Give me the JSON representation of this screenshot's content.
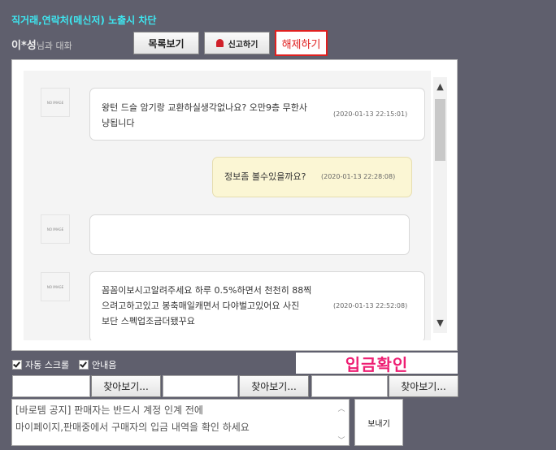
{
  "header": {
    "warning": "직거래,연락처(메신저) 노출시 차단",
    "user_name": "이*성",
    "user_suffix": "님과 대화",
    "list_button": "목록보기",
    "report_button": "신고하기",
    "release_button": "해제하기"
  },
  "chat": {
    "avatar_text": "NO IMAGE",
    "messages": [
      {
        "side": "them",
        "lines": [
          "왕턴 드슬 암기랑 교환하실생각없나요? 오만9층 무한사",
          "냥됩니다"
        ],
        "time": "(2020-01-13 22:15:01)"
      },
      {
        "side": "me",
        "lines": [
          "정보좀 볼수있을까요?"
        ],
        "time": "(2020-01-13 22:28:08)"
      },
      {
        "side": "them",
        "lines": [],
        "time": ""
      },
      {
        "side": "them",
        "lines": [
          "꼼꼼이보시고알려주세요 하루 0.5%하면서 천천히 88찍",
          "으려고하고있고 봉축매일캐면서 다야벌고있어요 사진",
          "보단 스펙업조금더됐꾸요"
        ],
        "time": "(2020-01-13 22:52:08)"
      }
    ]
  },
  "options": {
    "auto_scroll": "자동 스크롤",
    "guide": "안내음",
    "deposit_confirm": "입금확인"
  },
  "files": {
    "browse_label": "찾아보기..."
  },
  "composer": {
    "notice_line1": "[바로템 공지] 판매자는 반드시 계정 인계 전에",
    "notice_line2": "마이페이지,판매중에서 구매자의 입금 내역을 확인 하세요",
    "send_label": "보내기"
  },
  "colors": {
    "background": "#5f5f6d",
    "warning": "#3ee6f0",
    "release": "#e02020",
    "deposit": "#ee1f73",
    "my_bubble": "#fbf6d4"
  }
}
